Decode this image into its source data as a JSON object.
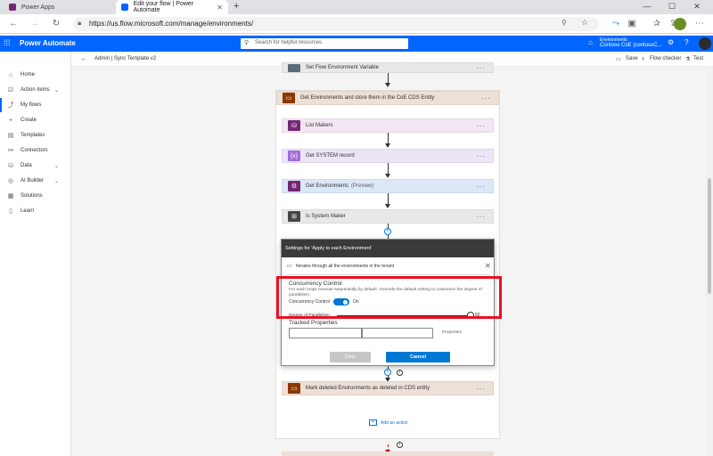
{
  "browser": {
    "tabs": [
      {
        "title": "Power Apps",
        "active": false
      },
      {
        "title": "Edit your flow | Power Automate",
        "active": true
      }
    ],
    "new_tab": "+",
    "url": "https://us.flow.microsoft.com/manage/environments/",
    "controls": {
      "minimize": "—",
      "maximize": "☐",
      "close": "✕"
    }
  },
  "header": {
    "app_name": "Power Automate",
    "search_placeholder": "Search for helpful resources",
    "env_label": "Environments",
    "env_name": "Contoso CoE (contosoC..."
  },
  "leftnav": {
    "items": [
      {
        "label": "Home",
        "icon": "home-icon",
        "chevron": false
      },
      {
        "label": "Action items",
        "icon": "checklist-icon",
        "chevron": true
      },
      {
        "label": "My flows",
        "icon": "flow-icon",
        "chevron": false,
        "active": true
      },
      {
        "label": "Create",
        "icon": "plus-icon",
        "chevron": false
      },
      {
        "label": "Templates",
        "icon": "template-icon",
        "chevron": false
      },
      {
        "label": "Connectors",
        "icon": "connector-icon",
        "chevron": false
      },
      {
        "label": "Data",
        "icon": "database-icon",
        "chevron": true
      },
      {
        "label": "AI Builder",
        "icon": "ai-icon",
        "chevron": true
      },
      {
        "label": "Solutions",
        "icon": "solutions-icon",
        "chevron": false
      },
      {
        "label": "Learn",
        "icon": "book-icon",
        "chevron": false
      }
    ]
  },
  "commandbar": {
    "breadcrumb": "Admin | Sync Template v2",
    "save": "Save",
    "flow_checker": "Flow checker",
    "test": "Test"
  },
  "flow": {
    "top_step": "Set Flow Environment Variable",
    "scope": "Get Environments and store them in the CoE CDS Entity",
    "steps": [
      {
        "label": "List Makers",
        "suffix": "",
        "color": "#742774",
        "bg": "#f2e7f2"
      },
      {
        "label": "Get SYSTEM record",
        "suffix": "",
        "color": "#a36bd8",
        "bg": "#ece4f7"
      },
      {
        "label": "Get Environments",
        "suffix": "(Preview)",
        "color": "#742774",
        "bg": "#dce8f8"
      },
      {
        "label": "Is System Maker",
        "suffix": "",
        "color": "#484644",
        "bg": "#e8e8e8"
      }
    ],
    "more": "···",
    "mark_deleted": "Mark deleted Environments as deleted in CDS entity",
    "add_action": "Add an action"
  },
  "settings": {
    "title": "Settings for 'Apply to each Environment'",
    "note": "Iterates through all the environments in the tenant",
    "concurrency_title": "Concurrency Control",
    "concurrency_desc": "For each loops execute sequentially by default. Override the default setting to customize the degree of parallelism.",
    "concurrency_label": "Concurrency Control",
    "toggle_state": "On",
    "toggle_on": true,
    "dop_label": "Degree of Parallelism",
    "dop_value": "50",
    "tracked_title": "Tracked Properties",
    "properties_label": "Properties",
    "done": "Done",
    "cancel": "Cancel"
  },
  "colors": {
    "brand": "#0066ff",
    "highlight": "#e81123",
    "primary_button": "#0078d4"
  }
}
